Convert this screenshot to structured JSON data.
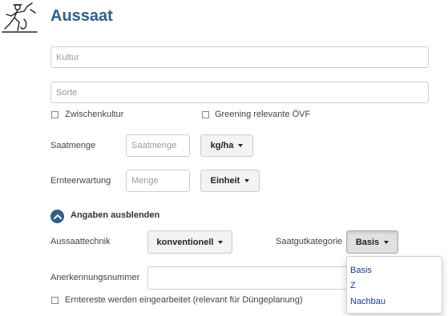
{
  "page": {
    "title": "Aussaat"
  },
  "form": {
    "kultur_placeholder": "Kultur",
    "sorte_placeholder": "Sorte",
    "zwischenkultur_label": "Zwischenkultur",
    "greening_label": "Greening relevante ÖVF",
    "saatmenge_label": "Saatmenge",
    "saatmenge_placeholder": "Saatmenge",
    "saatmenge_unit": "kg/ha",
    "ernteerwartung_label": "Ernteerwartung",
    "ernteerwartung_placeholder": "Menge",
    "ernteerwartung_unit": "Einheit",
    "toggle_label": "Angaben ausblenden",
    "aussaattechnik_label": "Aussaattechnik",
    "aussaattechnik_value": "konventionell",
    "saatgutkategorie_label": "Saatgutkategorie",
    "saatgutkategorie_value": "Basis",
    "saatgutkategorie_options": [
      "Basis",
      "Z",
      "Nachbau"
    ],
    "anerkennungsnummer_label": "Anerkennungsnummer",
    "anerkennungsnummer_value": "",
    "erntereste_label": "Erntereste werden eingearbeitet (relevant für Düngeplanung)"
  },
  "colors": {
    "title": "#2f5f8a",
    "toggle": "#2f5f8a",
    "dropdown_text": "#1a3a8a"
  },
  "icons": {
    "logo": "farmer-sowing-logo",
    "toggle": "chevron-up-icon"
  }
}
